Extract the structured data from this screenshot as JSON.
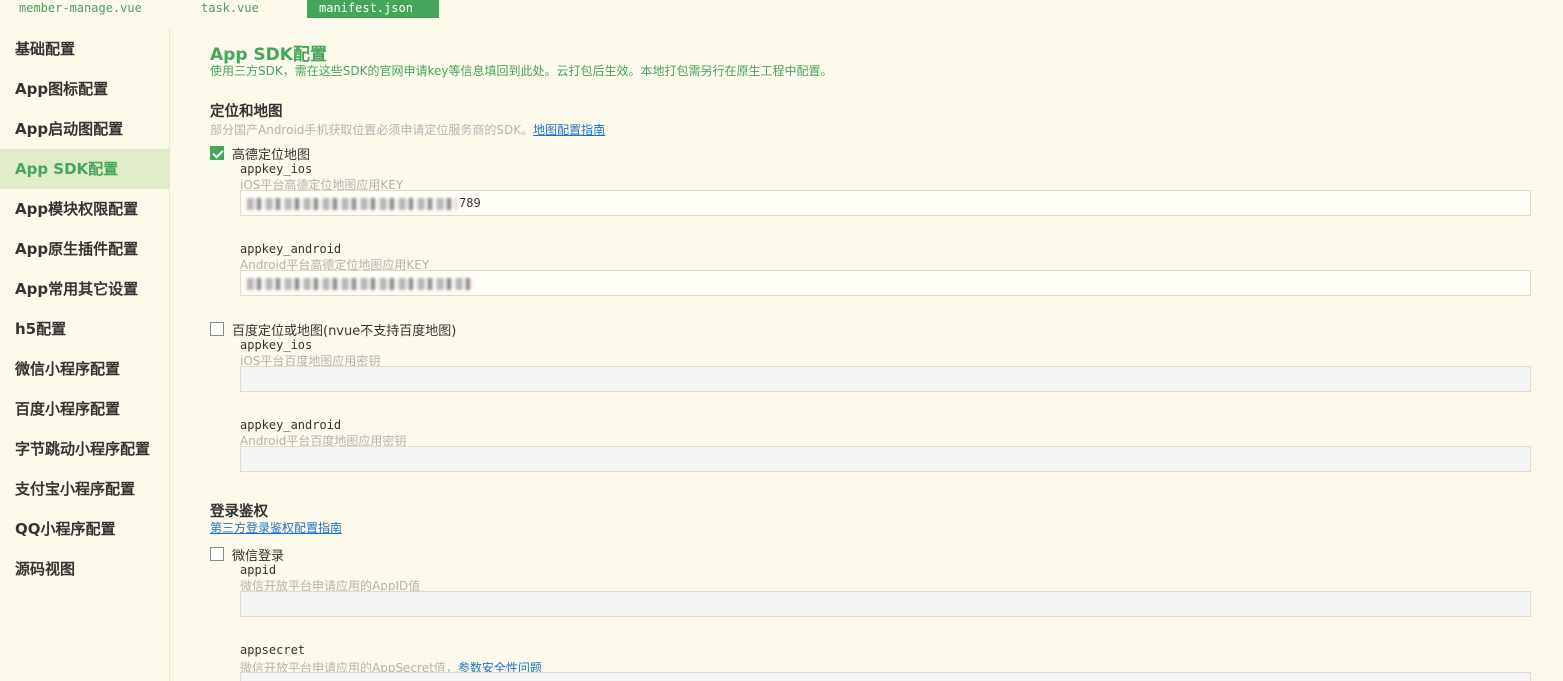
{
  "tabs": [
    {
      "label": "member-manage.vue",
      "active": false
    },
    {
      "label": "task.vue",
      "active": false
    },
    {
      "label": "manifest.json",
      "active": true
    }
  ],
  "sidebar": {
    "items": [
      {
        "label": "基础配置"
      },
      {
        "label": "App图标配置"
      },
      {
        "label": "App启动图配置"
      },
      {
        "label": "App SDK配置",
        "active": true
      },
      {
        "label": "App模块权限配置"
      },
      {
        "label": "App原生插件配置"
      },
      {
        "label": "App常用其它设置"
      },
      {
        "label": "h5配置"
      },
      {
        "label": "微信小程序配置"
      },
      {
        "label": "百度小程序配置"
      },
      {
        "label": "字节跳动小程序配置"
      },
      {
        "label": "支付宝小程序配置"
      },
      {
        "label": "QQ小程序配置"
      },
      {
        "label": "源码视图"
      }
    ]
  },
  "main": {
    "title": "App SDK配置",
    "description": "使用三方SDK，需在这些SDK的官网申请key等信息填回到此处。云打包后生效。本地打包需另行在原生工程中配置。",
    "location": {
      "heading": "定位和地图",
      "hint": "部分国产Android手机获取位置必须申请定位服务商的SDK。",
      "link": "地图配置指南",
      "amap": {
        "label": "高德定位地图",
        "checked": true,
        "ios_label": "appkey_ios",
        "ios_hint": "iOS平台高德定位地图应用KEY",
        "ios_value_tail": "789",
        "android_label": "appkey_android",
        "android_hint": "Android平台高德定位地图应用KEY"
      },
      "baidu": {
        "label": "百度定位或地图(nvue不支持百度地图)",
        "checked": false,
        "ios_label": "appkey_ios",
        "ios_hint": "iOS平台百度地图应用密钥",
        "ios_value": "",
        "android_label": "appkey_android",
        "android_hint": "Android平台百度地图应用密钥",
        "android_value": ""
      }
    },
    "login": {
      "heading": "登录鉴权",
      "link": "第三方登录鉴权配置指南",
      "wechat": {
        "label": "微信登录",
        "checked": false,
        "appid_label": "appid",
        "appid_hint": "微信开放平台申请应用的AppID值",
        "appid_value": "",
        "appsecret_label": "appsecret",
        "appsecret_hint": "微信开放平台申请应用的AppSecret值，",
        "appsecret_link": "参数安全性问题"
      }
    }
  },
  "colors": {
    "accent": "#43a65a",
    "background": "#fefaeb",
    "link": "#1a73c8"
  }
}
